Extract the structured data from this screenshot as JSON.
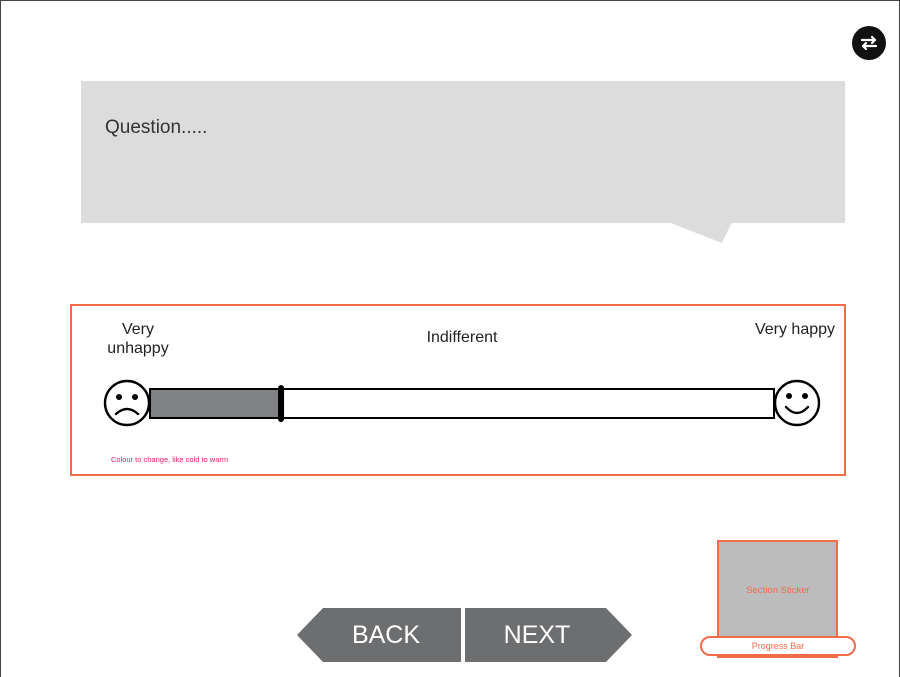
{
  "question": {
    "text": "Question....."
  },
  "scale": {
    "left_label": "Very unhappy",
    "center_label": "Indifferent",
    "right_label": "Very happy",
    "value": 0.21,
    "note": "Colour to change, like cold to warm",
    "left_icon": "sad-face-icon",
    "right_icon": "happy-face-icon"
  },
  "navigation": {
    "back_label": "BACK",
    "next_label": "NEXT"
  },
  "sticker": {
    "label": "Section Sticker"
  },
  "progress": {
    "label": "Progress Bar"
  },
  "toolbar": {
    "swap_icon": "swap-arrows-icon"
  },
  "colors": {
    "accent": "#f26b4b",
    "note": "#e0206d",
    "question_bg": "#dcdcdd",
    "nav_bg": "#6d6e70",
    "slider_fill": "#808184"
  }
}
